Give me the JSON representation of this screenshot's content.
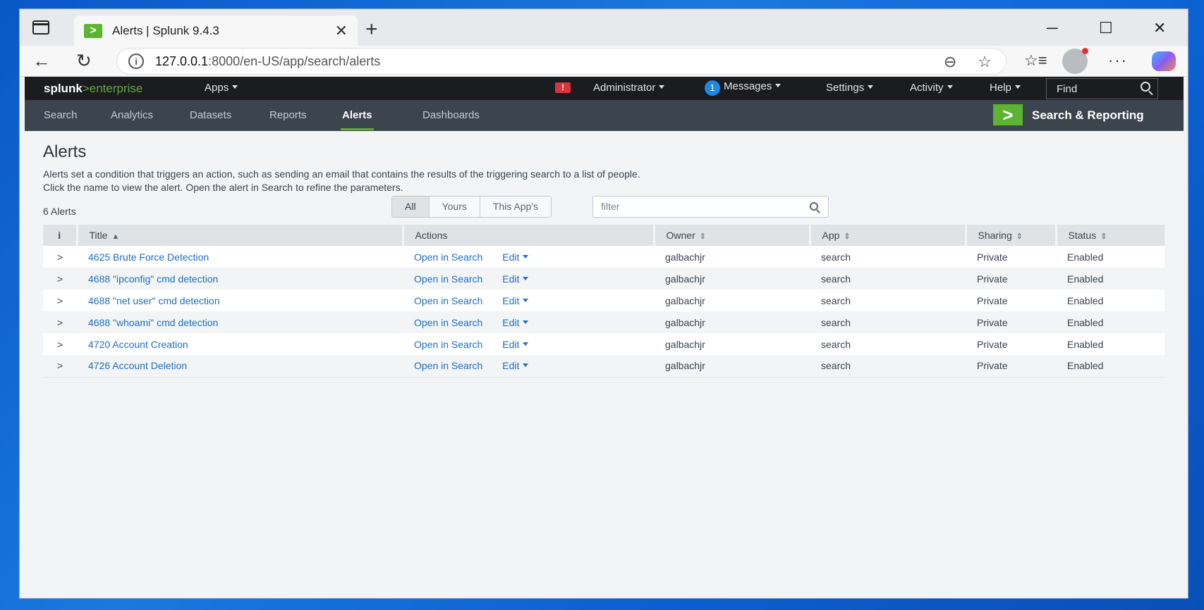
{
  "browser": {
    "tab_title": "Alerts | Splunk 9.4.3",
    "favicon_glyph": ">",
    "url_host": "127.0.0.1",
    "url_rest": ":8000/en-US/app/search/alerts"
  },
  "topbar": {
    "logo_splunk": "splunk",
    "logo_gt": ">",
    "logo_enterprise": "enterprise",
    "apps": "Apps",
    "alert_badge": "!",
    "administrator": "Administrator",
    "messages_count": "1",
    "messages": "Messages",
    "settings": "Settings",
    "activity": "Activity",
    "help": "Help",
    "find": "Find"
  },
  "appbar": {
    "items": [
      "Search",
      "Analytics",
      "Datasets",
      "Reports",
      "Alerts",
      "Dashboards"
    ],
    "active": "Alerts",
    "app_logo_glyph": ">",
    "app_title": "Search & Reporting"
  },
  "page": {
    "title": "Alerts",
    "description": "Alerts set a condition that triggers an action, such as sending an email that contains the results of the triggering search to a list of people. Click the name to view the alert. Open the alert in Search to refine the parameters.",
    "count": "6 Alerts",
    "filters": [
      "All",
      "Yours",
      "This App's"
    ],
    "filter_placeholder": "filter"
  },
  "table": {
    "headers": {
      "info": "i",
      "title": "Title",
      "actions": "Actions",
      "owner": "Owner",
      "app": "App",
      "sharing": "Sharing",
      "status": "Status"
    },
    "action_open": "Open in Search",
    "action_edit": "Edit",
    "rows": [
      {
        "title": "4625 Brute Force Detection",
        "owner": "galbachjr",
        "app": "search",
        "sharing": "Private",
        "status": "Enabled"
      },
      {
        "title": "4688 \"ipconfig\" cmd detection",
        "owner": "galbachjr",
        "app": "search",
        "sharing": "Private",
        "status": "Enabled"
      },
      {
        "title": "4688 \"net user\" cmd detection",
        "owner": "galbachjr",
        "app": "search",
        "sharing": "Private",
        "status": "Enabled"
      },
      {
        "title": "4688 \"whoami\" cmd detection",
        "owner": "galbachjr",
        "app": "search",
        "sharing": "Private",
        "status": "Enabled"
      },
      {
        "title": "4720 Account Creation",
        "owner": "galbachjr",
        "app": "search",
        "sharing": "Private",
        "status": "Enabled"
      },
      {
        "title": "4726 Account Deletion",
        "owner": "galbachjr",
        "app": "search",
        "sharing": "Private",
        "status": "Enabled"
      }
    ]
  }
}
